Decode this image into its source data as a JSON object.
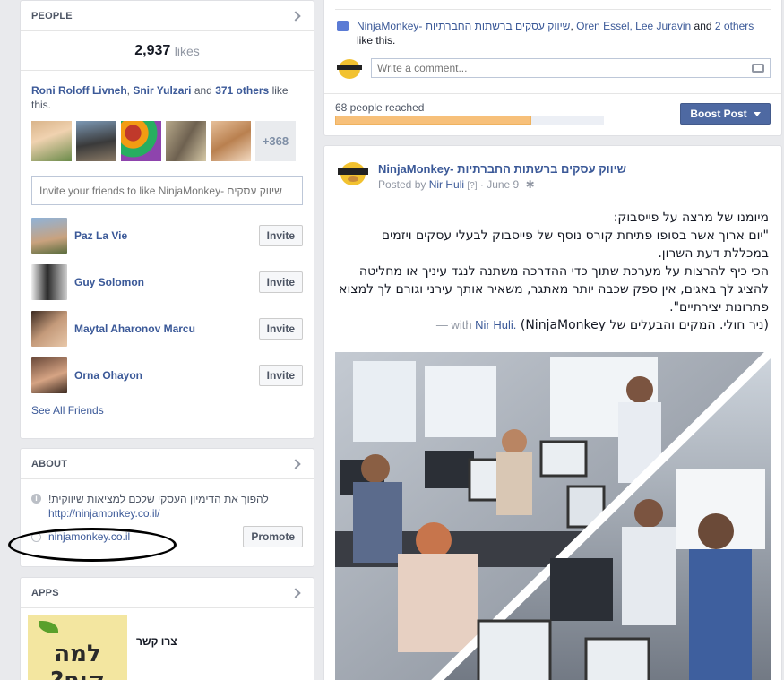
{
  "people": {
    "header": "PEOPLE",
    "likes_count": "2,937",
    "likes_label": "likes",
    "friends_like_names": [
      "Roni Roloff Livneh",
      "Snir Yulzari"
    ],
    "friends_like_and": "and",
    "friends_like_others": "371 others",
    "friends_like_suffix": "like this.",
    "more_count": "+368",
    "invite_placeholder": "Invite your friends to like NinjaMonkey- שיווק עסקים",
    "friends": [
      {
        "name": "Paz La Vie",
        "button": "Invite"
      },
      {
        "name": "Guy Solomon",
        "button": "Invite"
      },
      {
        "name": "Maytal Aharonov Marcu",
        "button": "Invite"
      },
      {
        "name": "Orna Ohayon",
        "button": "Invite"
      }
    ],
    "see_all": "See All Friends"
  },
  "about": {
    "header": "ABOUT",
    "description": "להפוך את הדימיון העסקי שלכם למציאות שיווקית!",
    "url": "http://ninjamonkey.co.il/",
    "website": "ninjamonkey.co.il",
    "promote_label": "Promote"
  },
  "apps": {
    "header": "APPS",
    "app_icon_text": "למה קוף?",
    "app_name": "צרו קשר"
  },
  "post_top": {
    "likers_page": "NinjaMonkey- שיווק עסקים ברשתות החברתיות",
    "likers_rest": "Oren Essel, Lee Juravin",
    "likers_and": "and",
    "likers_others": "2 others",
    "likers_suffix": "like this.",
    "comment_placeholder": "Write a comment...",
    "reached": "68 people reached",
    "reach_fraction": 0.73,
    "boost_label": "Boost Post"
  },
  "post": {
    "page_name": "NinjaMonkey- שיווק עסקים ברשתות החברתיות",
    "posted_by_label": "Posted by",
    "author": "Nir Huli",
    "meta_tag": "[?]",
    "date": "June 9",
    "lines": [
      "מיומנו של מרצה על פייסבוק:",
      "\"יום ארוך אשר בסופו פתיחת קורס נוסף של פייסבוק לבעלי עסקים ויזמים במכללת דעת השרון.",
      "הכי כיף להרצות על מערכת שתוך כדי ההדרכה משתנה לנגד עיניך או מחליטה להציג לך באגים, אין ספק שכבה יותר מאתגר, משאיר אותך עירני וגורם לך למצוא פתרונות יצירתיים\".",
      "(ניר חולי. המקים והבעלים של NinjaMonkey)"
    ],
    "with_label": "— with",
    "with_name": "Nir Huli."
  },
  "colors": {
    "fb_blue": "#3b5998",
    "boost_bg": "#4e69a2",
    "reach_bar": "#f7c07a"
  }
}
